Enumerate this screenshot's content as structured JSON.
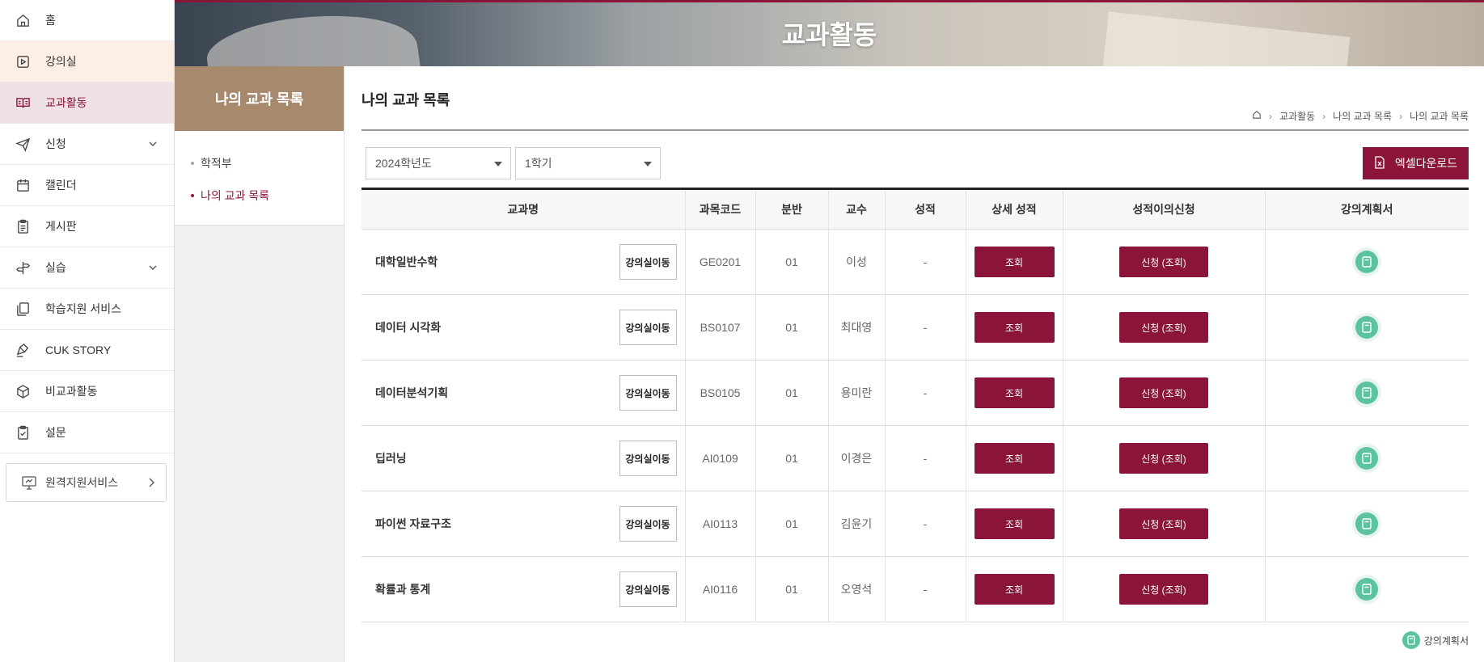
{
  "sidebar": {
    "items": [
      {
        "label": "홈",
        "icon": "home-icon"
      },
      {
        "label": "강의실",
        "icon": "play-square-icon"
      },
      {
        "label": "교과활동",
        "icon": "open-book-icon"
      },
      {
        "label": "신청",
        "icon": "paper-plane-icon"
      },
      {
        "label": "캘린더",
        "icon": "calendar-icon"
      },
      {
        "label": "게시판",
        "icon": "clipboard-icon"
      },
      {
        "label": "실습",
        "icon": "signpost-icon"
      },
      {
        "label": "학습지원 서비스",
        "icon": "copy-icon"
      },
      {
        "label": "CUK STORY",
        "icon": "pen-icon"
      },
      {
        "label": "비교과활동",
        "icon": "box-icon"
      },
      {
        "label": "설문",
        "icon": "clipboard-check-icon"
      }
    ],
    "remote_label": "원격지원서비스"
  },
  "banner": {
    "title": "교과활동"
  },
  "submenu": {
    "heading": "나의 교과 목록",
    "items": [
      "학적부",
      "나의 교과 목록"
    ]
  },
  "main": {
    "title": "나의 교과 목록",
    "breadcrumb": [
      "교과활동",
      "나의 교과 목록",
      "나의 교과 목록"
    ],
    "year_select": "2024학년도",
    "term_select": "1학기",
    "excel_label": "엑셀다운로드",
    "legend_label": "강의계획서"
  },
  "table": {
    "headers": [
      "교과명",
      "과목코드",
      "분반",
      "교수",
      "성적",
      "상세 성적",
      "성적이의신청",
      "강의계획서"
    ],
    "move_label": "강의실이동",
    "view_label": "조회",
    "apply_label": "신청 (조회)",
    "rows": [
      {
        "name": "대학일반수학",
        "code": "GE0201",
        "section": "01",
        "prof": "이성",
        "grade": "-"
      },
      {
        "name": "데이터 시각화",
        "code": "BS0107",
        "section": "01",
        "prof": "최대영",
        "grade": "-"
      },
      {
        "name": "데이터분석기획",
        "code": "BS0105",
        "section": "01",
        "prof": "용미란",
        "grade": "-"
      },
      {
        "name": "딥러닝",
        "code": "AI0109",
        "section": "01",
        "prof": "이경은",
        "grade": "-"
      },
      {
        "name": "파이썬 자료구조",
        "code": "AI0113",
        "section": "01",
        "prof": "김윤기",
        "grade": "-"
      },
      {
        "name": "확률과 통계",
        "code": "AI0116",
        "section": "01",
        "prof": "오영석",
        "grade": "-"
      }
    ]
  },
  "colors": {
    "accent": "#8b1538",
    "submenu_head": "#a78a6e",
    "plan_icon": "#5bc3a0"
  }
}
